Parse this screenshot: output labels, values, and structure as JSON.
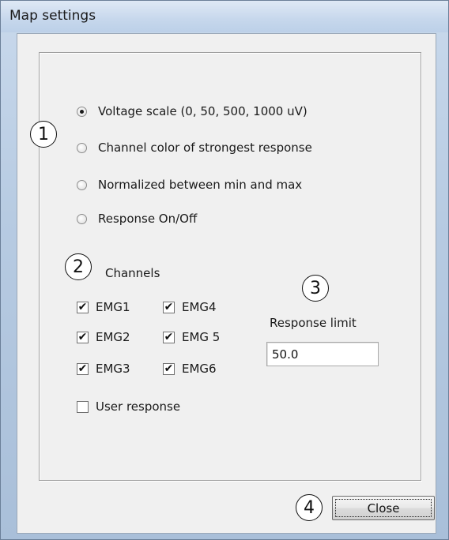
{
  "window": {
    "title": "Map settings"
  },
  "display_mode": {
    "options": [
      {
        "label": "Voltage scale  (0, 50, 500, 1000 uV)",
        "checked": true
      },
      {
        "label": "Channel color of strongest response",
        "checked": false
      },
      {
        "label": "Normalized between min and max",
        "checked": false
      },
      {
        "label": "Response On/Off",
        "checked": false
      }
    ]
  },
  "channels": {
    "heading": "Channels",
    "items": [
      {
        "label": "EMG1",
        "checked": true
      },
      {
        "label": "EMG4",
        "checked": true
      },
      {
        "label": "EMG2",
        "checked": true
      },
      {
        "label": "EMG 5",
        "checked": true
      },
      {
        "label": "EMG3",
        "checked": true
      },
      {
        "label": "EMG6",
        "checked": true
      }
    ],
    "user_response": {
      "label": "User response",
      "checked": false
    }
  },
  "response_limit": {
    "label": "Response limit",
    "value": "50.0"
  },
  "annotations": [
    "1",
    "2",
    "3",
    "4"
  ],
  "buttons": {
    "close_label": "Close"
  },
  "icons": {
    "check": "checkmark-icon"
  }
}
